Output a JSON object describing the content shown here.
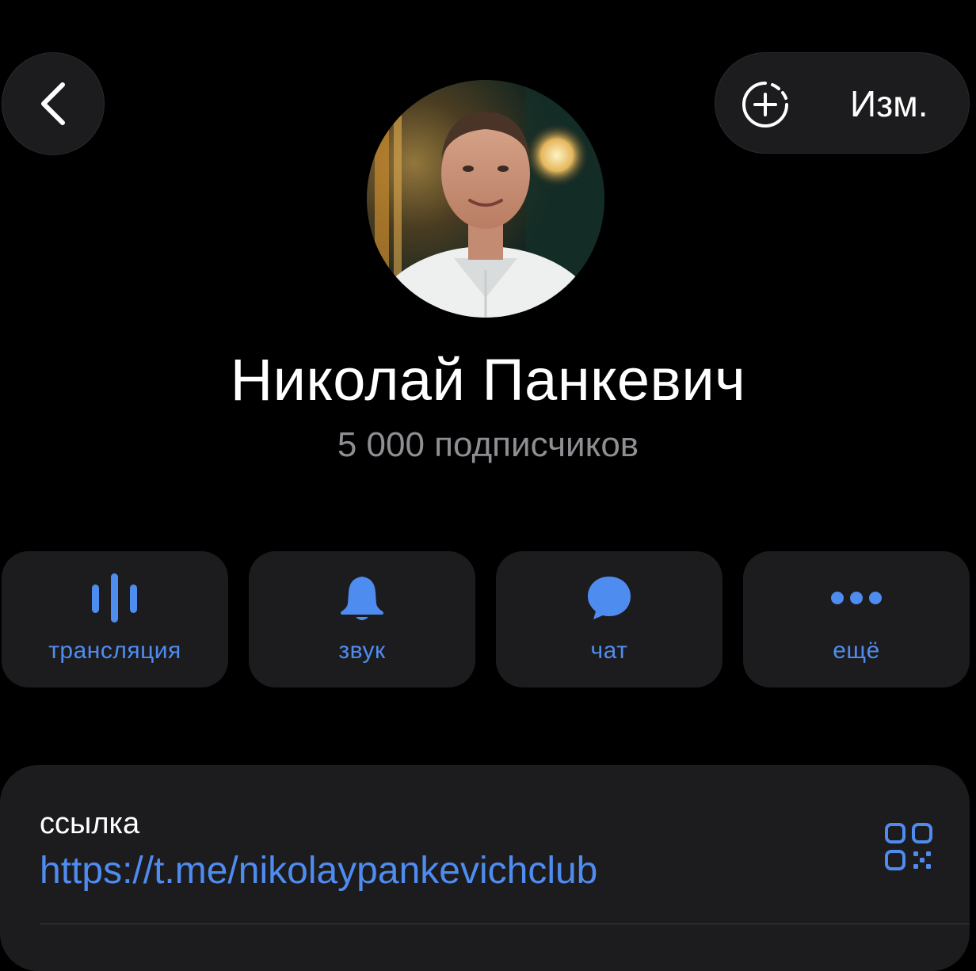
{
  "header": {
    "back_icon": "chevron-left-icon",
    "story_icon": "add-story-icon",
    "edit_label": "Изм."
  },
  "profile": {
    "avatar": "profile-photo",
    "name": "Николай Панкевич",
    "subscribers": "5 000 подписчиков"
  },
  "actions": [
    {
      "icon": "livestream-waveform-icon",
      "label": "трансляция"
    },
    {
      "icon": "bell-icon",
      "label": "звук"
    },
    {
      "icon": "chat-bubble-icon",
      "label": "чат"
    },
    {
      "icon": "more-dots-icon",
      "label": "ещё"
    }
  ],
  "info": {
    "link_caption": "ссылка",
    "link_value": "https://t.me/nikolaypankevichclub",
    "qr_icon": "qr-code-icon"
  },
  "colors": {
    "background": "#000000",
    "surface": "#1c1c1e",
    "accent": "#4f8cf0",
    "secondary_text": "#8e8e93"
  }
}
